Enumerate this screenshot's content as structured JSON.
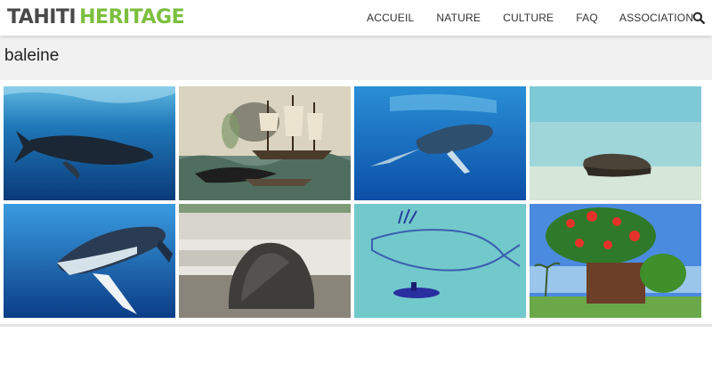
{
  "header": {
    "logo_part1": "TAHITI",
    "logo_part2": "HERITAGE",
    "nav": [
      "ACCUEIL",
      "NATURE",
      "CULTURE",
      "FAQ",
      "ASSOCIATION"
    ],
    "search_icon": "search-icon"
  },
  "page": {
    "title": "baleine"
  },
  "gallery": {
    "images": [
      "humpback-whale-swimming-underwater",
      "whaling-ship-painting",
      "whale-near-surface",
      "rock-in-lagoon",
      "humpback-whale-closeup",
      "stone-on-beach",
      "child-drawing-of-whale",
      "flowering-tree-in-planter"
    ]
  },
  "colors": {
    "logo_dark": "#4a4a4a",
    "logo_green": "#7cbf3e",
    "title_bar": "#f1f1f1"
  }
}
